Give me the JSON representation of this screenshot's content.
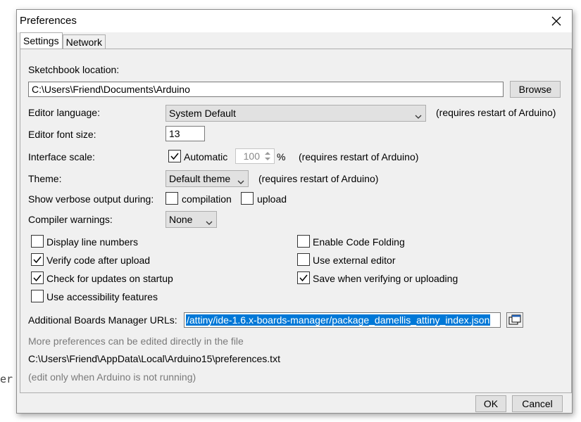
{
  "background": {
    "fragment": "er"
  },
  "window": {
    "title": "Preferences",
    "close_icon": "close-icon"
  },
  "tabs": [
    {
      "label": "Settings",
      "active": true
    },
    {
      "label": "Network",
      "active": false
    }
  ],
  "settings": {
    "sketchbook": {
      "label": "Sketchbook location:",
      "value": "C:\\Users\\Friend\\Documents\\Arduino",
      "browse_label": "Browse"
    },
    "language": {
      "label": "Editor language:",
      "value": "System Default",
      "note": "(requires restart of Arduino)"
    },
    "font_size": {
      "label": "Editor font size:",
      "value": "13"
    },
    "scale": {
      "label": "Interface scale:",
      "automatic_label": "Automatic",
      "automatic_checked": true,
      "value": "100",
      "unit": "%",
      "note": "(requires restart of Arduino)"
    },
    "theme": {
      "label": "Theme:",
      "value": "Default theme",
      "note": "(requires restart of Arduino)"
    },
    "verbose": {
      "label": "Show verbose output during:",
      "compilation_label": "compilation",
      "compilation_checked": false,
      "upload_label": "upload",
      "upload_checked": false
    },
    "warnings": {
      "label": "Compiler warnings:",
      "value": "None"
    },
    "options_left": [
      {
        "label": "Display line numbers",
        "checked": false
      },
      {
        "label": "Verify code after upload",
        "checked": true
      },
      {
        "label": "Check for updates on startup",
        "checked": true
      },
      {
        "label": "Use accessibility features",
        "checked": false
      }
    ],
    "options_right": [
      {
        "label": "Enable Code Folding",
        "checked": false
      },
      {
        "label": "Use external editor",
        "checked": false
      },
      {
        "label": "Save when verifying or uploading",
        "checked": true
      }
    ],
    "boards_urls": {
      "label": "Additional Boards Manager URLs:",
      "value": "/attiny/ide-1.6.x-boards-manager/package_damellis_attiny_index.json"
    },
    "more_prefs": "More preferences can be edited directly in the file",
    "prefs_path": "C:\\Users\\Friend\\AppData\\Local\\Arduino15\\preferences.txt",
    "edit_note": "(edit only when Arduino is not running)"
  },
  "footer": {
    "ok_label": "OK",
    "cancel_label": "Cancel"
  },
  "colors": {
    "selection": "#0078d7",
    "dialog_bg": "#f0f0f0",
    "gray_text": "#7a7a7a"
  }
}
